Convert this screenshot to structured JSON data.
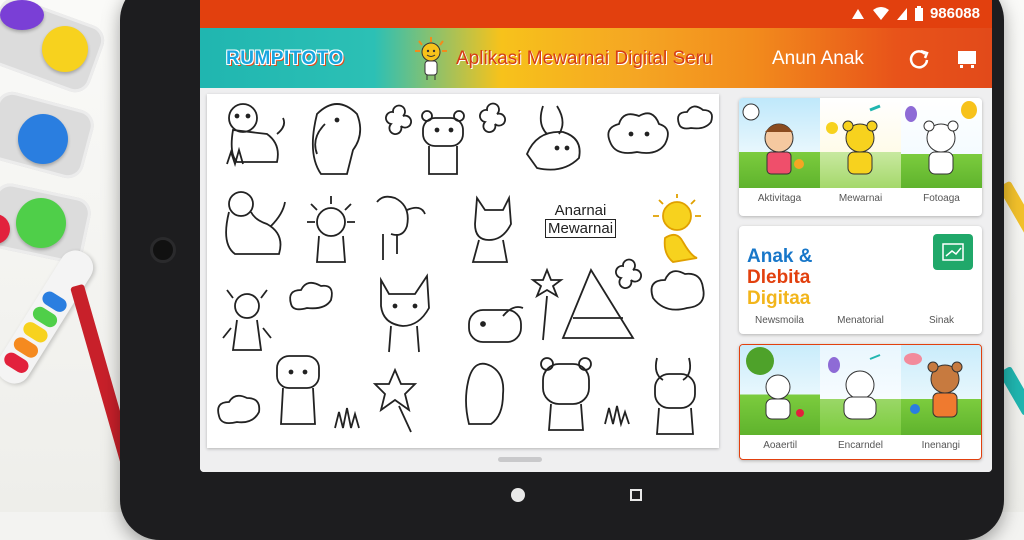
{
  "status_bar": {
    "time": "986088"
  },
  "app_bar": {
    "brand": "RUMPITOTO",
    "title": "Aplikasi Mewarnai Digital Seru",
    "nav_link": "Anun Anak"
  },
  "canvas": {
    "label_line1": "Anarnai",
    "label_line2": "Mewarnai"
  },
  "gallery_top": {
    "captions": [
      "Aktivitaga",
      "Mewarnai",
      "Fotoaga"
    ]
  },
  "promo": {
    "title_line1": "Anak &",
    "title_line2": "Dlebita",
    "title_line3": "Digitaa",
    "captions": [
      "Newsmoila",
      "Menatorial",
      "Sinak"
    ]
  },
  "gallery_bottom": {
    "captions": [
      "Aoaertil",
      "Encarndel",
      "Inenangi"
    ]
  },
  "colors": {
    "status_bar": "#e2400e",
    "brand": "#1aa6e0",
    "title": "#d63d16",
    "badge": "#20a86a"
  }
}
